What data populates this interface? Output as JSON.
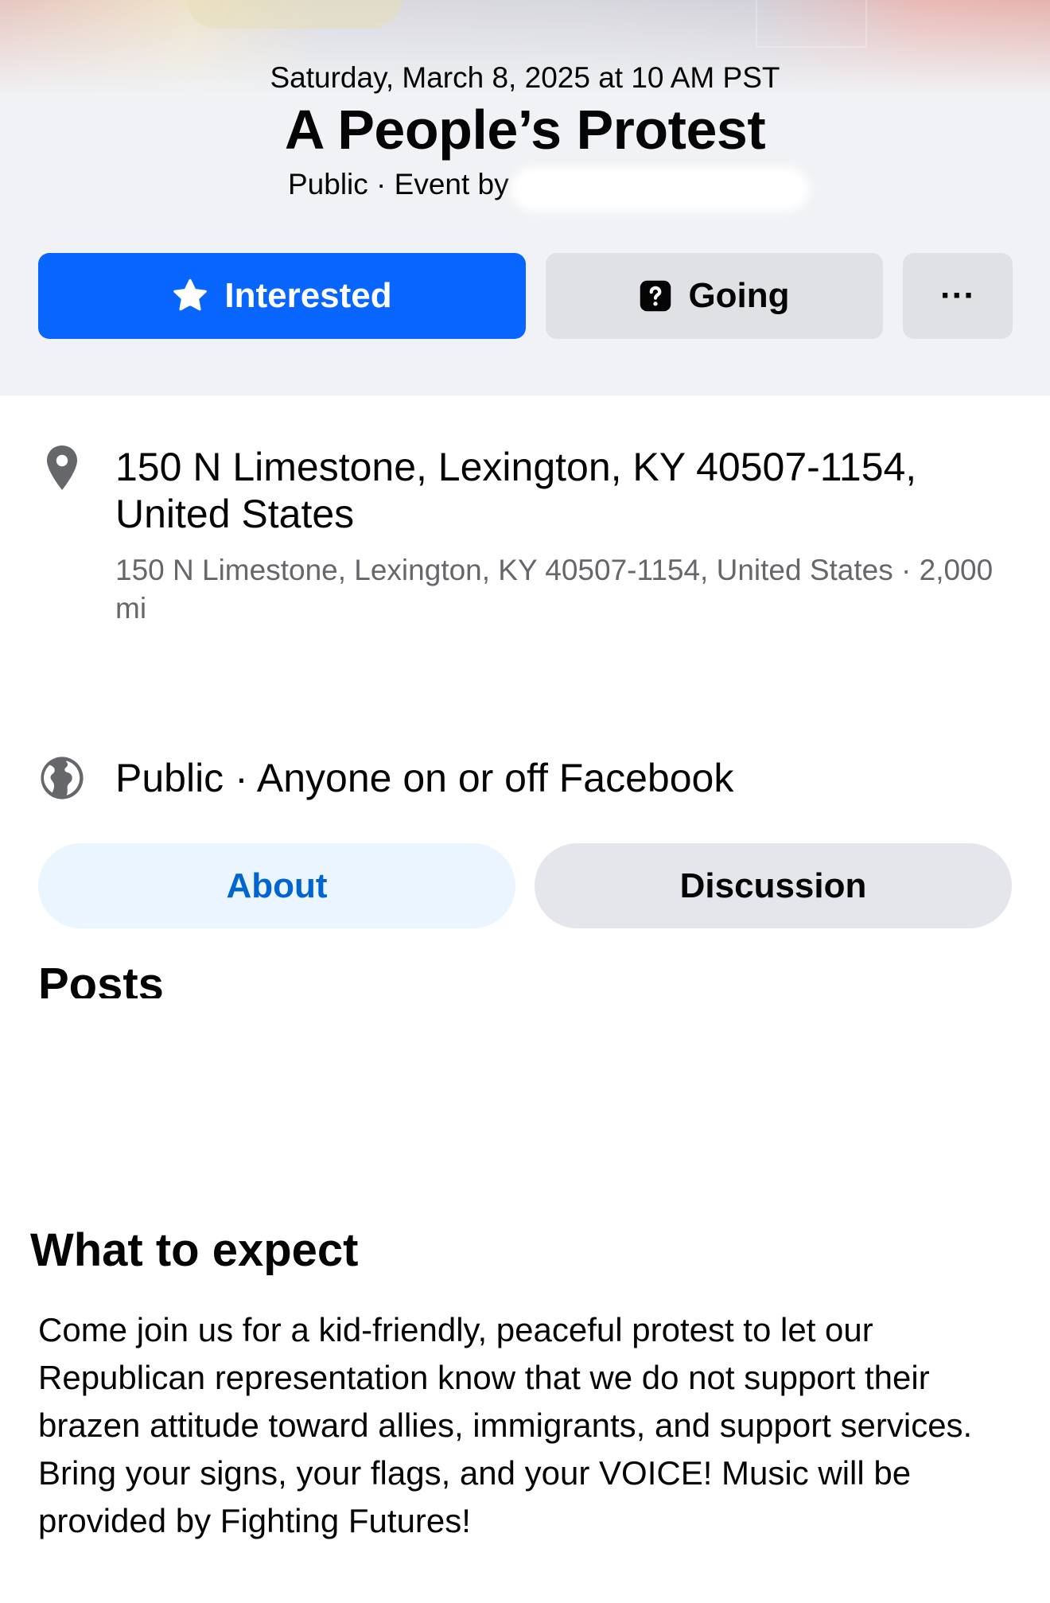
{
  "event": {
    "datetime": "Saturday, March 8, 2025 at 10 AM PST",
    "title": "A People’s Protest",
    "meta": "Public · Event by"
  },
  "actions": {
    "interested_label": "Interested",
    "going_label": "Going",
    "more_label": "···"
  },
  "location": {
    "name": "150 N Limestone, Lexington, KY 40507-1154, United States",
    "detail": "150 N Limestone, Lexington, KY 40507-1154, United States · 2,000 mi"
  },
  "privacy": {
    "text": "Public · Anyone on or off Facebook"
  },
  "tabs": {
    "about": "About",
    "discussion": "Discussion"
  },
  "posts": {
    "heading": "Posts"
  },
  "expect": {
    "heading": "What to expect",
    "body": "Come join us for a kid-friendly, peaceful protest to let our Republican representation know that we do not support their brazen attitude toward allies, immigrants, and support services. Bring your signs, your flags, and your VOICE! Music will be provided by Fighting Futures!"
  },
  "colors": {
    "primary": "#0866ff",
    "header_bg": "#f0f2f5",
    "secondary_button": "#dfe1e5",
    "tab_active_bg": "#ebf5ff",
    "tab_active_text": "#0064d1",
    "muted_text": "#65676b",
    "icon": "#65676b"
  },
  "icons": {
    "interested": "star-icon",
    "going": "question-mark-icon",
    "more": "more-dots-icon",
    "location": "map-pin-icon",
    "privacy": "globe-icon"
  }
}
